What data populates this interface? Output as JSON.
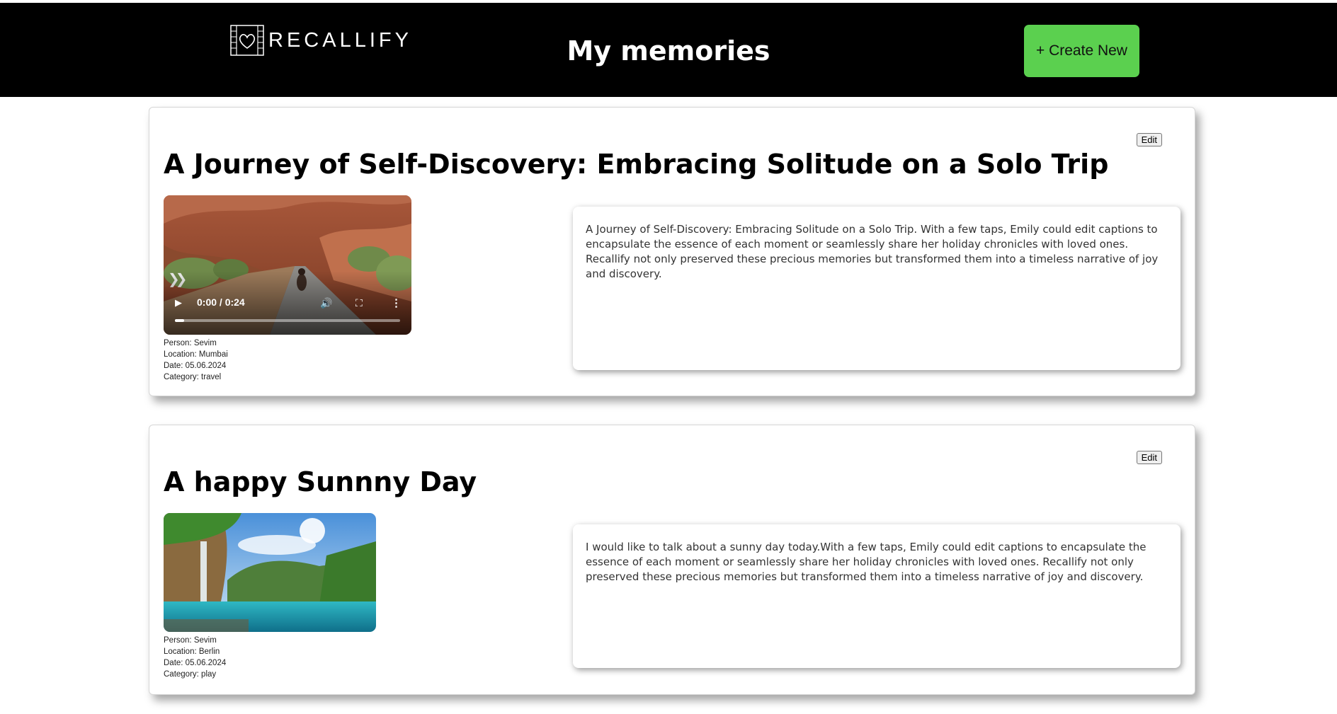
{
  "header": {
    "logo_text": "RECALLIFY",
    "title": "My memories",
    "create_button": "+ Create New"
  },
  "memories": [
    {
      "title": "A Journey of Self-Discovery: Embracing Solitude on a Solo Trip",
      "edit_label": "Edit",
      "media_type": "video",
      "video": {
        "time": "0:00 / 0:24",
        "progress": 0.04,
        "play_icon": "play-icon",
        "volume_icon": "volume-icon",
        "fullscreen_icon": "fullscreen-icon",
        "more_icon": "more-options-icon"
      },
      "meta": {
        "person": "Person: Sevim",
        "location": "Location: Mumbai",
        "date": "Date: 05.06.2024",
        "category": "Category: travel"
      },
      "description": "A Journey of Self-Discovery: Embracing Solitude on a Solo Trip. With a few taps, Emily could edit captions to encapsulate the essence of each moment or seamlessly share her holiday chronicles with loved ones. Recallify not only preserved these precious memories but transformed them into a timeless narrative of joy and discovery."
    },
    {
      "title": "A happy Sunnny Day",
      "edit_label": "Edit",
      "media_type": "image",
      "meta": {
        "person": "Person: Sevim",
        "location": "Location: Berlin",
        "date": "Date: 05.06.2024",
        "category": "Category: play"
      },
      "description": "I would like to talk about a sunny day today.With a few taps, Emily could edit captions to encapsulate the essence of each moment or seamlessly share her holiday chronicles with loved ones. Recallify not only preserved these precious memories but transformed them into a timeless narrative of joy and discovery."
    }
  ],
  "colors": {
    "header_bg": "#000000",
    "create_button_bg": "#5bd04f"
  }
}
